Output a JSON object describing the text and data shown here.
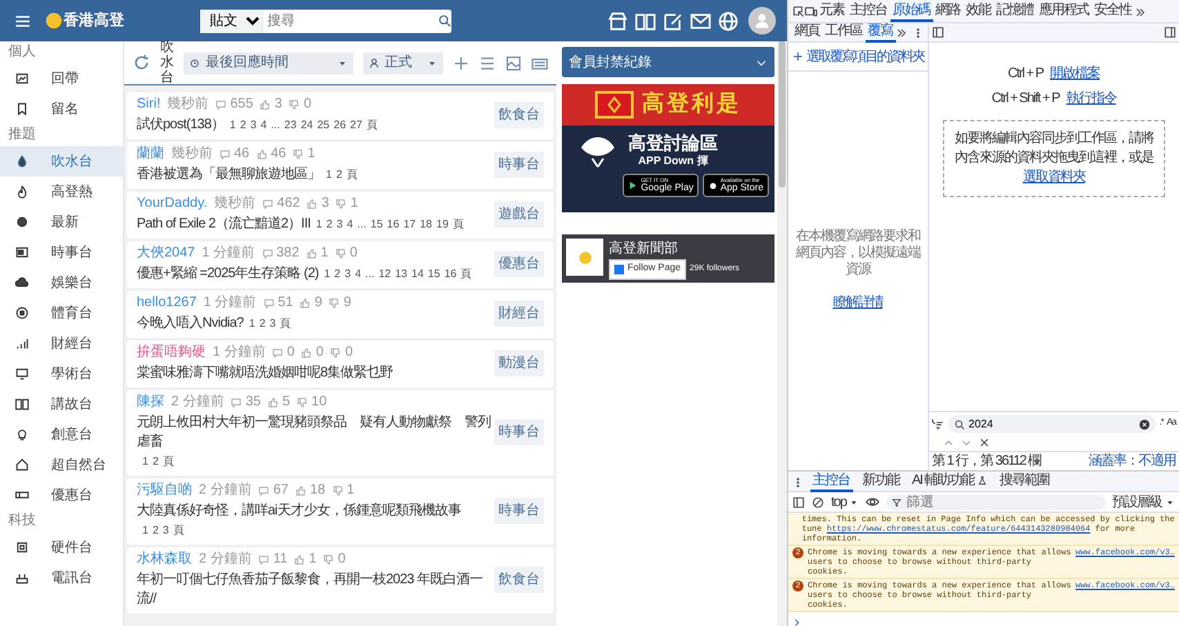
{
  "header": {
    "logo": "香港高登",
    "search_scope": "貼文",
    "search_placeholder": "搜尋"
  },
  "sidebar": {
    "sections": [
      {
        "title": "個人",
        "items": [
          {
            "label": "回帶",
            "selected": false
          },
          {
            "label": "留名",
            "selected": false
          }
        ]
      },
      {
        "title": "推題",
        "items": [
          {
            "label": "吹水台",
            "selected": true
          },
          {
            "label": "高登熱",
            "selected": false
          },
          {
            "label": "最新",
            "selected": false
          },
          {
            "label": "時事台",
            "selected": false
          },
          {
            "label": "娛樂台",
            "selected": false
          },
          {
            "label": "體育台",
            "selected": false
          },
          {
            "label": "財經台",
            "selected": false
          },
          {
            "label": "學術台",
            "selected": false
          },
          {
            "label": "講故台",
            "selected": false
          },
          {
            "label": "創意台",
            "selected": false
          },
          {
            "label": "超自然台",
            "selected": false
          },
          {
            "label": "優惠台",
            "selected": false
          }
        ]
      },
      {
        "title": "科技",
        "items": [
          {
            "label": "硬件台",
            "selected": false
          },
          {
            "label": "電訊台",
            "selected": false
          }
        ]
      }
    ]
  },
  "toolbar": {
    "channel": "吹水台",
    "sort": "最後回應時間",
    "mode": "正式"
  },
  "threads": [
    {
      "author": "Siri!",
      "color": "#3a8ee6",
      "time": "幾秒前",
      "replies": "655",
      "likes": "3",
      "dislikes": "0",
      "title": "試伏post(138）",
      "pages": {
        "first": [
          "1",
          "2",
          "3",
          "4"
        ],
        "gap": "...",
        "last": [
          "23",
          "24",
          "25",
          "26",
          "27"
        ]
      },
      "pages_label": "頁",
      "board": "飲食台"
    },
    {
      "author": "蘭蘭",
      "color": "#3a8ee6",
      "time": "幾秒前",
      "replies": "46",
      "likes": "46",
      "dislikes": "1",
      "title": "香港被選為「最無聊旅遊地區」",
      "pages": {
        "first": [
          "1",
          "2"
        ]
      },
      "pages_label": "頁",
      "board": "時事台"
    },
    {
      "author": "YourDaddy.",
      "color": "#3a8ee6",
      "time": "幾秒前",
      "replies": "462",
      "likes": "3",
      "dislikes": "1",
      "title": "Path of Exile 2（流亡黯道2）III",
      "pages": {
        "first": [
          "1",
          "2",
          "3",
          "4"
        ],
        "gap": "...",
        "last": [
          "15",
          "16",
          "17",
          "18",
          "19"
        ]
      },
      "pages_label": "頁",
      "board": "遊戲台"
    },
    {
      "author": "大俠2047",
      "color": "#3a8ee6",
      "time": "1 分鐘前",
      "replies": "382",
      "likes": "1",
      "dislikes": "0",
      "title": "優惠+緊縮 =2025年生存策略 (2)",
      "pages": {
        "first": [
          "1",
          "2",
          "3",
          "4"
        ],
        "gap": "...",
        "last": [
          "12",
          "13",
          "14",
          "15",
          "16"
        ]
      },
      "pages_label": "頁",
      "board": "優惠台"
    },
    {
      "author": "hello1267",
      "color": "#3a8ee6",
      "time": "1 分鐘前",
      "replies": "51",
      "likes": "9",
      "dislikes": "9",
      "title": "今晚入唔入Nvidia?",
      "pages": {
        "first": [
          "1",
          "2",
          "3"
        ]
      },
      "pages_label": "頁",
      "board": "財經台"
    },
    {
      "author": "拚蛋唔夠硬",
      "color": "#e8508a",
      "time": "1 分鐘前",
      "replies": "0",
      "likes": "0",
      "dislikes": "0",
      "title": "棠蜜味雅濤下嘴就唔洗婚姻咁呢8集做緊乜野",
      "board": "動漫台"
    },
    {
      "author": "陳探",
      "color": "#3a8ee6",
      "time": "2 分鐘前",
      "replies": "35",
      "likes": "5",
      "dislikes": "10",
      "title": "元朗上攸田村大年初一驚現豬頭祭品　疑有人動物獻祭　警列虐畜",
      "pages": {
        "first": [
          "1",
          "2"
        ]
      },
      "pages_label": "頁",
      "board": "時事台"
    },
    {
      "author": "污駆自啲",
      "color": "#3a8ee6",
      "time": "2 分鐘前",
      "replies": "67",
      "likes": "18",
      "dislikes": "1",
      "title": "大陸真係好奇怪，講咩ai天才少女，係鍾意呢類飛機故事",
      "pages": {
        "first": [
          "1",
          "2",
          "3"
        ]
      },
      "pages_label": "頁",
      "board": "時事台"
    },
    {
      "author": "水林森取",
      "color": "#3a8ee6",
      "time": "2 分鐘前",
      "replies": "11",
      "likes": "1",
      "dislikes": "0",
      "title": "年初一叮個七仔魚香茄子飯黎食，再開一枝2023 年既白酒一流//",
      "board": "飲食台"
    }
  ],
  "ban_panel": {
    "title": "會員封禁紀錄"
  },
  "ad": {
    "heading": "高登利是",
    "app_title": "高登討論區",
    "app_subtitle": "APP Down 揮",
    "stores": [
      {
        "caption": "GET IT ON",
        "name": "Google Play"
      },
      {
        "caption": "Available on the",
        "name": "App Store"
      }
    ]
  },
  "facebook": {
    "page_name": "高登新聞部",
    "button": "Follow Page",
    "followers": "29K followers"
  },
  "devtools": {
    "tabs": [
      {
        "label": "元素",
        "selected": false
      },
      {
        "label": "主控台",
        "selected": false
      },
      {
        "label": "原始碼",
        "selected": true
      },
      {
        "label": "網路",
        "selected": false
      },
      {
        "label": "效能",
        "selected": false
      },
      {
        "label": "記憶體",
        "selected": false
      },
      {
        "label": "應用程式",
        "selected": false
      },
      {
        "label": "安全性",
        "selected": false
      }
    ],
    "sub_tabs": [
      {
        "label": "網頁",
        "selected": false
      },
      {
        "label": "工作區",
        "selected": false
      },
      {
        "label": "覆寫",
        "selected": true
      }
    ],
    "add_folder": "選取覆寫項目的資料夾",
    "overrides_hint": "在本機覆寫網路要求和網頁內容，以模擬遠端資源",
    "learn_more": "瞭解詳情",
    "shortcuts": [
      {
        "keys": "Ctrl + P",
        "action": "開啟檔案"
      },
      {
        "keys": "Ctrl + Shift + P",
        "action": "執行指令"
      }
    ],
    "drop_hint": "如要將編輯內容同步到工作區，請將內含來源的資料夾拖曳到這裡，或是",
    "select_folder": "選取資料夾",
    "search": {
      "value": "2024",
      "regex": ".*",
      "match_case": "Aa"
    },
    "position": "第 1 行，第 36112 欄",
    "coverage": "涵蓋率：不適用",
    "drawer_tabs": [
      {
        "label": "主控台",
        "selected": true
      },
      {
        "label": "新功能",
        "selected": false
      },
      {
        "label": "AI 輔助功能",
        "selected": false
      },
      {
        "label": "搜尋範圍",
        "selected": false
      }
    ],
    "context": "top",
    "filter_placeholder": "篩選",
    "levels": "預設層級",
    "messages": [
      {
        "kind": "warning",
        "text": "times. This can be reset in Page Info which can be accessed by clicking the tune",
        "link": "https://www.chromestatus.com/feature/6443143280984064",
        "suffix": "for more information."
      },
      {
        "kind": "warning",
        "count": "2",
        "text": "Chrome is moving towards a new experience that allows users to choose to browse without third-party cookies.",
        "source": "www.facebook.com/v3…"
      },
      {
        "kind": "warning",
        "count": "2",
        "text": "Chrome is moving towards a new experience that allows users to choose to browse without third-party cookies.",
        "source": "www.facebook.com/v3…"
      }
    ]
  }
}
